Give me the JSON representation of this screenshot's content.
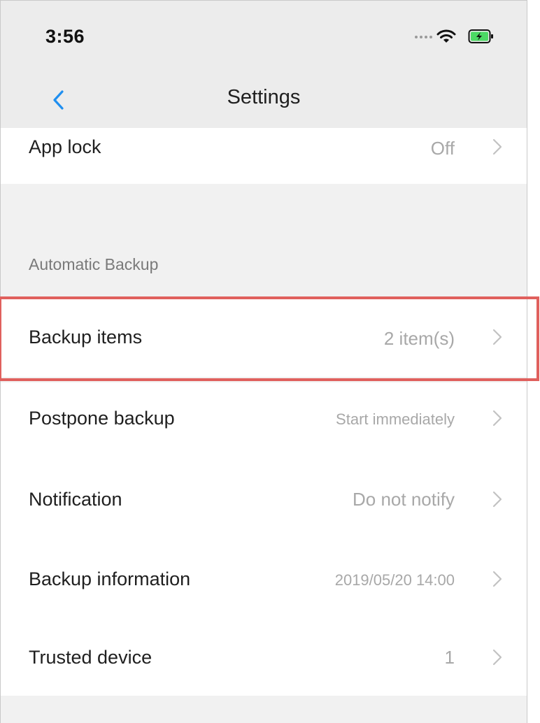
{
  "status_bar": {
    "time": "3:56"
  },
  "nav": {
    "title": "Settings"
  },
  "rows_top": [
    {
      "label": "App lock",
      "value": "Off"
    }
  ],
  "section": {
    "header": "Automatic Backup",
    "rows": [
      {
        "label": "Backup items",
        "value": "2 item(s)"
      },
      {
        "label": "Postpone backup",
        "value": "Start immediately"
      },
      {
        "label": "Notification",
        "value": "Do not notify"
      },
      {
        "label": "Backup information",
        "value": "2019/05/20 14:00"
      },
      {
        "label": "Trusted device",
        "value": "1"
      }
    ]
  },
  "colors": {
    "accent": "#1f8ff0",
    "highlight": "#e0605d",
    "secondary_text": "#a8a8a8",
    "background": "#f1f1f1"
  },
  "icons": {
    "back": "chevron-left-icon",
    "row": "chevron-right-icon",
    "wifi": "wifi-icon",
    "battery": "battery-charging-icon"
  }
}
